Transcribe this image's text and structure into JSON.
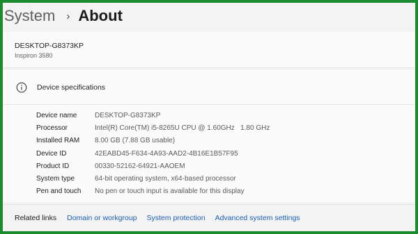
{
  "breadcrumb": {
    "parent": "System",
    "separator": "›",
    "current": "About"
  },
  "device": {
    "name": "DESKTOP-G8373KP",
    "model": "Inspiron 3580"
  },
  "specs": {
    "title": "Device specifications",
    "icon": "info-icon",
    "rows": [
      {
        "label": "Device name",
        "value": "DESKTOP-G8373KP"
      },
      {
        "label": "Processor",
        "value": "Intel(R) Core(TM) i5-8265U CPU @ 1.60GHz   1.80 GHz"
      },
      {
        "label": "Installed RAM",
        "value": "8.00 GB (7.88 GB usable)"
      },
      {
        "label": "Device ID",
        "value": "42EABD45-F634-4A93-AAD2-4B16E1B57F95"
      },
      {
        "label": "Product ID",
        "value": "00330-52162-64921-AAOEM"
      },
      {
        "label": "System type",
        "value": "64-bit operating system, x64-based processor"
      },
      {
        "label": "Pen and touch",
        "value": "No pen or touch input is available for this display"
      }
    ]
  },
  "related": {
    "title": "Related links",
    "links": [
      "Domain or workgroup",
      "System protection",
      "Advanced system settings"
    ]
  },
  "colors": {
    "border": "#1a8c2e",
    "link": "#1a5fb4",
    "background": "#f3f3f3",
    "card": "#fbfbfb"
  }
}
